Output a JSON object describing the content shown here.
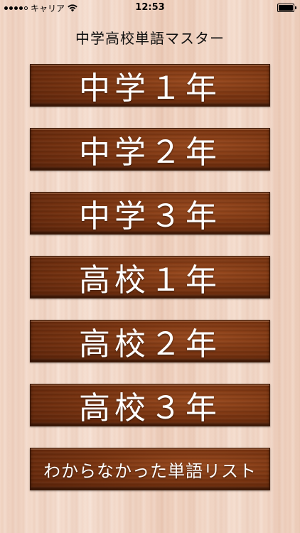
{
  "status_bar": {
    "carrier": "キャリア",
    "time": "12:53"
  },
  "app_title": "中学高校単語マスター",
  "menu": {
    "items": [
      {
        "label": "中学１年"
      },
      {
        "label": "中学２年"
      },
      {
        "label": "中学３年"
      },
      {
        "label": "高校１年"
      },
      {
        "label": "高校２年"
      },
      {
        "label": "高校３年"
      },
      {
        "label": "わからなかった単語リスト"
      }
    ]
  },
  "colors": {
    "button_wood": "#7a3410",
    "background_wood": "#f3d8c8"
  }
}
